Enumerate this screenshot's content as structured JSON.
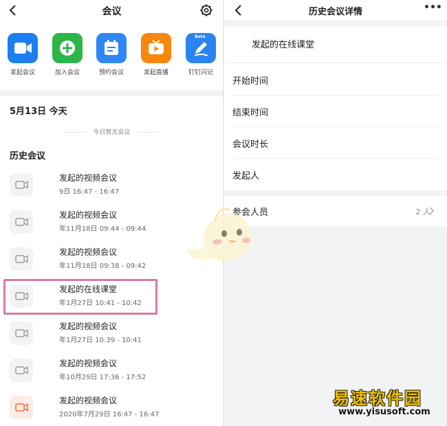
{
  "left": {
    "title": "会议",
    "apps": [
      {
        "label": "发起会议",
        "color": "#1d7ef0",
        "icon": "video-camera-icon"
      },
      {
        "label": "加入会议",
        "color": "#2db54a",
        "icon": "join-plus-icon"
      },
      {
        "label": "预约会议",
        "color": "#2f86f5",
        "icon": "calendar-icon"
      },
      {
        "label": "发起直播",
        "color": "#f7870f",
        "icon": "live-tv-icon"
      },
      {
        "label": "钉钉闪记",
        "color": "#2c84f0",
        "icon": "pen-note-icon",
        "badge": "Beta"
      }
    ],
    "date_label": "5月13日 今天",
    "empty_today": "今日暂无会议",
    "history_label": "历史会议",
    "history": [
      {
        "title": "发起的视频会议",
        "time": "9日 16:47 - 16:47",
        "icon": "video-icon",
        "accent": false
      },
      {
        "title": "发起的视频会议",
        "time": "年11月18日 09:44 - 09:44",
        "icon": "video-icon",
        "accent": false
      },
      {
        "title": "发起的视频会议",
        "time": "年11月18日 09:38 - 09:42",
        "icon": "video-icon",
        "accent": false
      },
      {
        "title": "发起的在线课堂",
        "time": "年1月27日 10:41 - 10:42",
        "icon": "video-icon",
        "accent": false
      },
      {
        "title": "发起的视频会议",
        "time": "年1月27日 10:39 - 10:41",
        "icon": "video-icon",
        "accent": false
      },
      {
        "title": "发起的视频会议",
        "time": "年10月29日 17:36 - 17:52",
        "icon": "video-icon",
        "accent": false
      },
      {
        "title": "发起的视频会议",
        "time": "2020年7月29日 16:47 - 16:47",
        "icon": "video-icon",
        "accent": true
      }
    ]
  },
  "right": {
    "title": "历史会议详情",
    "meeting_name": "发起的在线课堂",
    "fields": [
      "开始时间",
      "结束时间",
      "会议时长",
      "发起人"
    ],
    "participants_label": "参会人员",
    "participants_count": "2 人"
  },
  "watermark": {
    "name": "易速软件园",
    "url": "www.yisusoft.com"
  },
  "colors": {
    "highlight": "#d77aa3",
    "accent_orange": "#f5703a"
  }
}
